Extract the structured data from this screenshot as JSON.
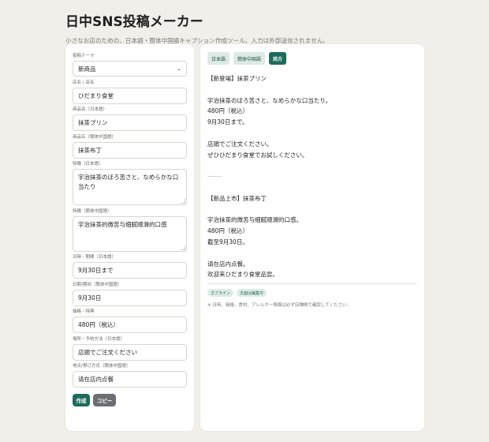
{
  "header": {
    "title": "日中SNS投稿メーカー",
    "subtitle": "小さなお店のための、日本語・簡体中国語キャプション作成ツール。入力は外部送信されません。"
  },
  "form": {
    "fields": [
      {
        "label": "投稿テーマ",
        "value": "新商品",
        "type": "select"
      },
      {
        "label": "店名 / 店名",
        "value": "ひだまり食堂",
        "type": "input"
      },
      {
        "label": "商品名（日本語）",
        "value": "抹茶プリン",
        "type": "input"
      },
      {
        "label": "商品名（簡体中国語）",
        "value": "抹茶布丁",
        "type": "input"
      },
      {
        "label": "特徴（日本語）",
        "value": "宇治抹茶のほろ苦さと、なめらかな口当たり",
        "type": "textarea"
      },
      {
        "label": "特徴（簡体中国語）",
        "value": "宇治抹茶的微苦与细腻顺滑的口感",
        "type": "textarea"
      },
      {
        "label": "日時・期間（日本語）",
        "value": "9月30日まで",
        "type": "input"
      },
      {
        "label": "日期/期间（簡体中国語）",
        "value": "9月30日",
        "type": "input"
      },
      {
        "label": "価格・特典",
        "value": "480円（税込）",
        "type": "input"
      },
      {
        "label": "場所・予約方法（日本語）",
        "value": "店頭でご注文ください",
        "type": "input"
      },
      {
        "label": "地点/预订方式（簡体中国語）",
        "value": "请在店内点餐",
        "type": "input"
      }
    ],
    "create_label": "作成",
    "copy_label": "コピー"
  },
  "preview": {
    "tabs": [
      {
        "label": "日本語",
        "active": false
      },
      {
        "label": "簡体中国語",
        "active": false
      },
      {
        "label": "両方",
        "active": true
      }
    ],
    "lines": [
      "【新登場】抹茶プリン",
      "",
      "宇治抹茶のほろ苦さと、なめらかな口当たり。",
      "480円（税込）",
      "9月30日まで。",
      "",
      "店頭でご注文ください。",
      "ぜひひだまり食堂でお試しください。",
      "",
      "———",
      "",
      "【新品上市】抹茶布丁",
      "",
      "宇治抹茶的微苦与细腻顺滑的口感。",
      "480円（税込）",
      "截至9月30日。",
      "",
      "请在店内点餐。",
      "欢迎来ひだまり食堂品尝。"
    ],
    "badges": [
      "オフライン",
      "文面は編集可"
    ],
    "note": "※ 日時、価格、食材、アレルギー情報は必ず店舗側で確認してください。"
  },
  "colors": {
    "background": "#f1efe9",
    "accent": "#1d6b5c",
    "copy_button": "#6b6f73",
    "tab_inactive": "#dce9e4"
  }
}
